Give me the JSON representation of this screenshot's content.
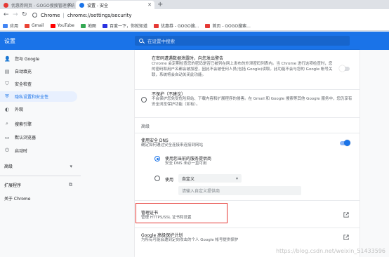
{
  "browser": {
    "tabs": [
      {
        "title": "优惠券网页 - GOGO搜搜管理系统",
        "favicon_color": "#e53935"
      },
      {
        "title": "设置 - 安全",
        "favicon_color": "#1a73e8"
      }
    ],
    "new_tab_glyph": "+",
    "address": {
      "prefix": "Chrome",
      "url": "chrome://settings/security"
    },
    "bookmarks": [
      {
        "label": "应用",
        "color": "#4285f4"
      },
      {
        "label": "Gmail",
        "color": "#ea4335"
      },
      {
        "label": "YouTube",
        "color": "#ff0000"
      },
      {
        "label": "地图",
        "color": "#34a853"
      },
      {
        "label": "百度一下，你就知道",
        "color": "#2932e1"
      },
      {
        "label": "优惠券 - GOGO搜...",
        "color": "#e53935"
      },
      {
        "label": "首页 - GOGO搜索...",
        "color": "#e53935"
      }
    ]
  },
  "header": {
    "title": "设置",
    "search_placeholder": "在设置中搜索"
  },
  "sidebar": {
    "items": [
      {
        "label": "您与 Google",
        "icon": "person-icon"
      },
      {
        "label": "自动填充",
        "icon": "autofill-icon"
      },
      {
        "label": "安全检查",
        "icon": "shield-check-icon"
      },
      {
        "label": "隐私设置和安全性",
        "icon": "shield-icon"
      },
      {
        "label": "外观",
        "icon": "palette-icon"
      },
      {
        "label": "搜索引擎",
        "icon": "search-icon"
      },
      {
        "label": "默认浏览器",
        "icon": "browser-icon"
      },
      {
        "label": "启动时",
        "icon": "power-icon"
      }
    ],
    "advanced": "高级",
    "extensions": "扩展程序",
    "about": "关于 Chrome"
  },
  "main": {
    "password_warning": {
      "title": "在密码遭遇数据泄露时，向您发出警告",
      "desc": "Chrome 会定期检查您的密码是否已被列在网上发布的外泄密码列表内。当 Chrome 进行这项检查时，您的密码和用户名都会被加密，因此不会被任何人员(包括 Google)读取。此功能不会与您的 Google 帐号关联，系统将会自动关闭此功能。"
    },
    "no_protection": {
      "title": "不保护（不建议）",
      "desc": "不会保护您免受危险网站、下载内容和扩展程序的侵害。在 Gmail 和 Google 搜索等其他 Google 服务中，您仍享有安全浏览保护功能（如有）。"
    },
    "advanced_label": "高级",
    "secure_dns": {
      "title": "使用安全 DNS",
      "desc": "确定如何通过安全连接来连接到网站",
      "option1_title": "使用您当前的服务提供商",
      "option1_desc": "安全 DNS 未必一直可用",
      "option2_label": "使用",
      "option2_select": "自定义",
      "custom_placeholder": "请输入自定义提供商"
    },
    "manage_certs": {
      "title": "管理证书",
      "desc": "管理 HTTPS/SSL 证书和设置"
    },
    "google_protection": {
      "title": "Google 高级保护计划",
      "desc": "为所有可能会遭到定向攻击的个人 Google 帐号提供保护"
    }
  },
  "watermark": "https://blog.csdn.net/weixin_51433596",
  "colors": {
    "accent": "#1a73e8",
    "highlight": "#e53935"
  }
}
